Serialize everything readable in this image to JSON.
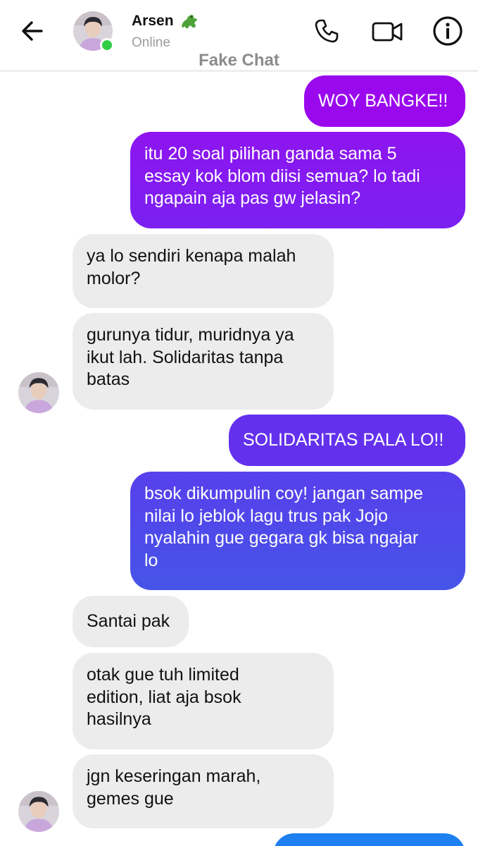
{
  "header": {
    "name": "Arsen",
    "status": "Online",
    "watermark": "Fake Chat"
  },
  "colors": {
    "online": "#31cc46",
    "sent_top": "#9a09ee",
    "sent_bottom": "#4654e8",
    "received": "#ececec"
  },
  "icons": [
    "back-arrow-icon",
    "crocodile-emoji-icon",
    "phone-icon",
    "video-camera-icon",
    "info-icon"
  ],
  "messages": [
    {
      "side": "sent",
      "text": "WOY BANGKE!!"
    },
    {
      "side": "sent",
      "text": "itu 20 soal pilihan ganda sama 5\nessay kok blom diisi semua? lo tadi\nngapain aja pas gw jelasin?"
    },
    {
      "side": "received",
      "text": "ya lo sendiri kenapa malah\nmolor?"
    },
    {
      "side": "received",
      "text": "gurunya tidur, muridnya ya\nikut lah. Solidaritas tanpa\nbatas"
    },
    {
      "side": "sent",
      "text": "SOLIDARITAS PALA LO!!"
    },
    {
      "side": "sent",
      "text": "bsok dikumpulin coy! jangan sampe\nnilai lo jeblok lagu trus pak Jojo\nnyalahin gue gegara gk bisa ngajar\nlo"
    },
    {
      "side": "received",
      "text": "Santai pak"
    },
    {
      "side": "received",
      "text": "otak gue tuh limited\nedition, liat aja bsok\nhasilnya"
    },
    {
      "side": "received",
      "text": "jgn keseringan marah,\ngemes gue"
    }
  ]
}
